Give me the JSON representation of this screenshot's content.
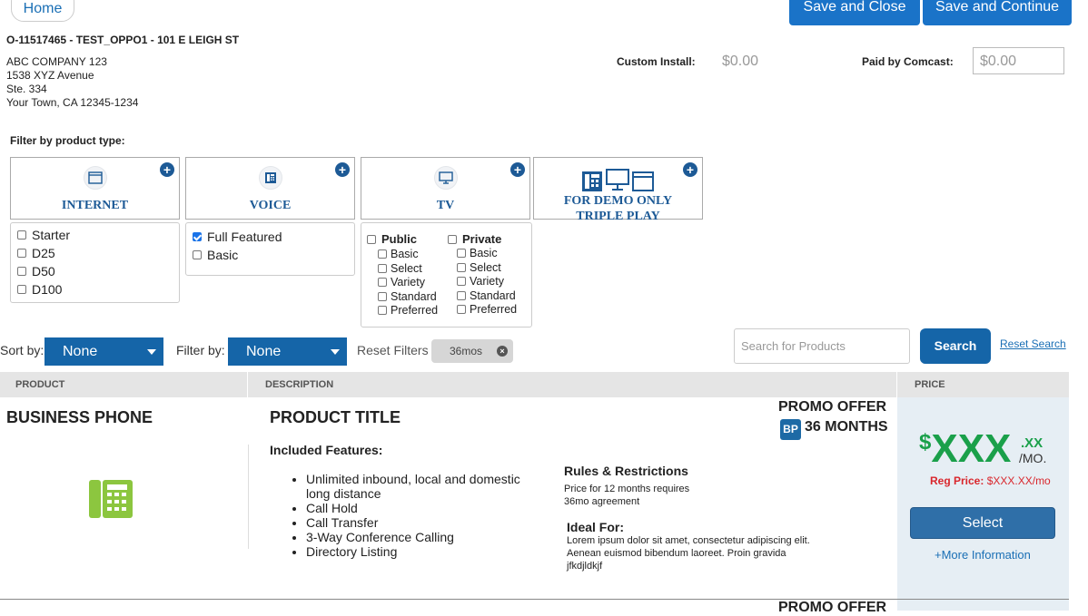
{
  "header": {
    "home_label": "Home",
    "save_close_label": "Save and Close",
    "save_continue_label": "Save and Continue"
  },
  "order": {
    "title": "O-11517465 - TEST_OPPO1 - 101 E LEIGH ST",
    "address_lines": [
      "ABC COMPANY 123",
      "1538 XYZ Avenue",
      "Ste. 334",
      "Your Town, CA 12345-1234"
    ]
  },
  "fees": {
    "custom_install_label": "Custom Install:",
    "custom_install_value": "$0.00",
    "paid_by_label": "Paid by Comcast:",
    "paid_by_value": "$0.00"
  },
  "filter": {
    "title": "Filter by product type:",
    "product_types": [
      {
        "label": "INTERNET",
        "icon": "browser-window-icon"
      },
      {
        "label": "VOICE",
        "icon": "desk-phone-icon"
      },
      {
        "label": "TV",
        "icon": "monitor-icon"
      },
      {
        "label_line1": "FOR DEMO ONLY",
        "label_line2": "TRIPLE PLAY",
        "icon": "triple-play-icon"
      }
    ],
    "internet_options": [
      {
        "label": "Starter",
        "checked": false
      },
      {
        "label": "D25",
        "checked": false
      },
      {
        "label": "D50",
        "checked": false
      },
      {
        "label": "D100",
        "checked": false
      }
    ],
    "voice_options": [
      {
        "label": "Full Featured",
        "checked": true
      },
      {
        "label": "Basic",
        "checked": false
      }
    ],
    "tv": {
      "public_label": "Public",
      "private_label": "Private",
      "public_options": [
        "Basic",
        "Select",
        "Variety",
        "Standard",
        "Preferred"
      ],
      "private_options": [
        "Basic",
        "Select",
        "Variety",
        "Standard",
        "Preferred"
      ]
    }
  },
  "toolbar": {
    "sort_label": "Sort by:",
    "sort_value": "None",
    "filter_label": "Filter by:",
    "filter_value": "None",
    "reset_filters_label": "Reset Filters",
    "chip_label": "36mos",
    "search_placeholder": "Search for Products",
    "search_button": "Search",
    "reset_search": "Reset Search"
  },
  "table": {
    "headers": {
      "product": "PRODUCT",
      "description": "DESCRIPTION",
      "price": "PRICE"
    },
    "row": {
      "product_type": "BUSINESS PHONE",
      "product_title": "PRODUCT TITLE",
      "promo_label": "PROMO OFFER",
      "promo_badge": "BP",
      "promo_term": "36 MONTHS",
      "features_title": "Included Features:",
      "features": [
        "Unlimited inbound, local and domestic long distance",
        "Call Hold",
        "Call Transfer",
        "3-Way Conference Calling",
        "Directory Listing"
      ],
      "rules_title": "Rules & Restrictions",
      "rules_lines": [
        "Price for 12 months requires",
        "36mo agreement"
      ],
      "ideal_title": "Ideal For:",
      "ideal_text": "Lorem ipsum dolor sit amet, consectetur adipiscing elit. Aenean euismod bibendum laoreet. Proin gravida jfkdjldkjf",
      "price_dollar": "$",
      "price_main": "XXX",
      "price_cents": ".XX",
      "price_unit": "/MO.",
      "reg_price_label": "Reg Price:",
      "reg_price_value": "$XXX.XX/mo",
      "select_label": "Select",
      "more_info_label": "+More Information"
    },
    "next_row_promo_label": "PROMO OFFER"
  },
  "colors": {
    "primary_blue": "#1a73c8",
    "dark_blue": "#1565a8",
    "price_green": "#1aa04a",
    "reg_price_red": "#d9262c",
    "phone_icon_green": "#8cc63f"
  }
}
